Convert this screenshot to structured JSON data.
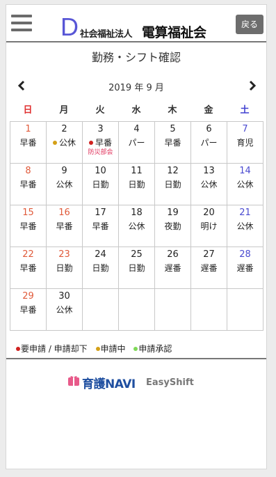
{
  "header": {
    "logo_letter": "D",
    "org_type": "社会福祉法人",
    "org_name": "電算福祉会",
    "back_label": "戻る"
  },
  "page_title": "勤務・シフト確認",
  "month_label": "2019 年 9 月",
  "weekdays": [
    "日",
    "月",
    "火",
    "水",
    "木",
    "金",
    "土"
  ],
  "colors": {
    "required": "#d0211f",
    "pending": "#d4a017",
    "approved": "#7ed957",
    "note": "#e0305a"
  },
  "weeks": [
    [
      {
        "day": "1",
        "shift": "早番"
      },
      {
        "day": "2",
        "shift": "公休",
        "status": "pending"
      },
      {
        "day": "3",
        "shift": "早番",
        "status": "required",
        "note": "防災部会"
      },
      {
        "day": "4",
        "shift": "パー"
      },
      {
        "day": "5",
        "shift": "早番"
      },
      {
        "day": "6",
        "shift": "パー"
      },
      {
        "day": "7",
        "shift": "育児"
      }
    ],
    [
      {
        "day": "8",
        "shift": "早番"
      },
      {
        "day": "9",
        "shift": "公休"
      },
      {
        "day": "10",
        "shift": "日勤"
      },
      {
        "day": "11",
        "shift": "日勤"
      },
      {
        "day": "12",
        "shift": "日勤"
      },
      {
        "day": "13",
        "shift": "公休"
      },
      {
        "day": "14",
        "shift": "公休"
      }
    ],
    [
      {
        "day": "15",
        "shift": "早番"
      },
      {
        "day": "16",
        "shift": "早番",
        "holiday": true
      },
      {
        "day": "17",
        "shift": "早番"
      },
      {
        "day": "18",
        "shift": "公休"
      },
      {
        "day": "19",
        "shift": "夜勤"
      },
      {
        "day": "20",
        "shift": "明け"
      },
      {
        "day": "21",
        "shift": "公休"
      }
    ],
    [
      {
        "day": "22",
        "shift": "早番"
      },
      {
        "day": "23",
        "shift": "日勤",
        "holiday": true
      },
      {
        "day": "24",
        "shift": "日勤"
      },
      {
        "day": "25",
        "shift": "日勤"
      },
      {
        "day": "26",
        "shift": "遅番"
      },
      {
        "day": "27",
        "shift": "遅番"
      },
      {
        "day": "28",
        "shift": "遅番"
      }
    ],
    [
      {
        "day": "29",
        "shift": "早番"
      },
      {
        "day": "30",
        "shift": "公休"
      },
      {},
      {},
      {},
      {},
      {}
    ]
  ],
  "legend": {
    "required": "要申請 / 申請却下",
    "pending": "申請中",
    "approved": "申請承認"
  },
  "footer": {
    "brand_main": "育護NAVI",
    "brand_sub": "EasyShift"
  }
}
